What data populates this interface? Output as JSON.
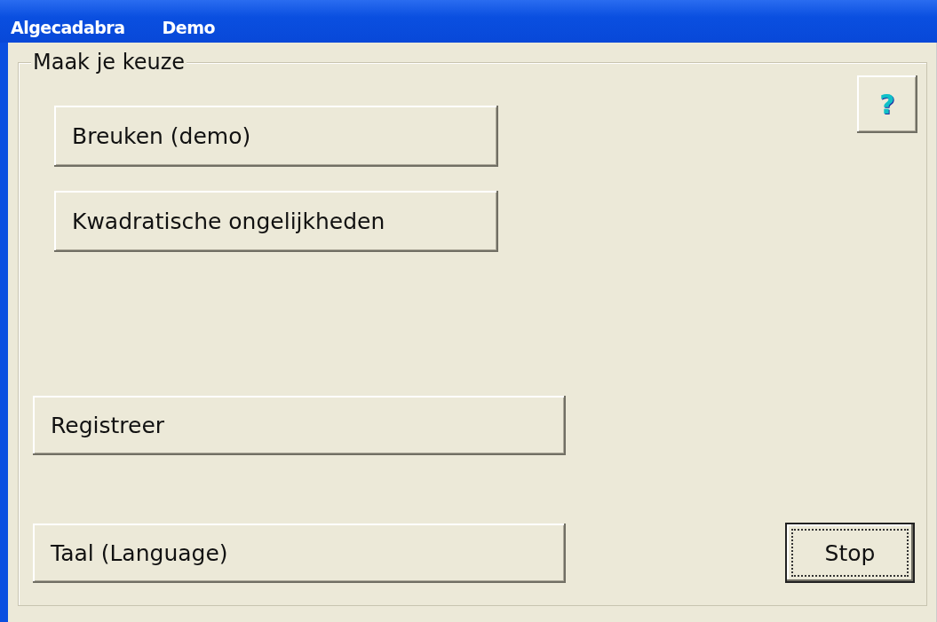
{
  "menu_bar": {
    "items": [
      "Algecadabra",
      "Demo"
    ]
  },
  "group": {
    "title": "Maak je keuze"
  },
  "help_button": {
    "label": "?"
  },
  "topic_buttons": [
    {
      "label": "Breuken (demo)"
    },
    {
      "label": "Kwadratische ongelijkheden"
    }
  ],
  "register_button": {
    "label": "Registreer"
  },
  "language_button": {
    "label": "Taal (Language)"
  },
  "stop_button": {
    "label": "Stop",
    "focused": true
  }
}
